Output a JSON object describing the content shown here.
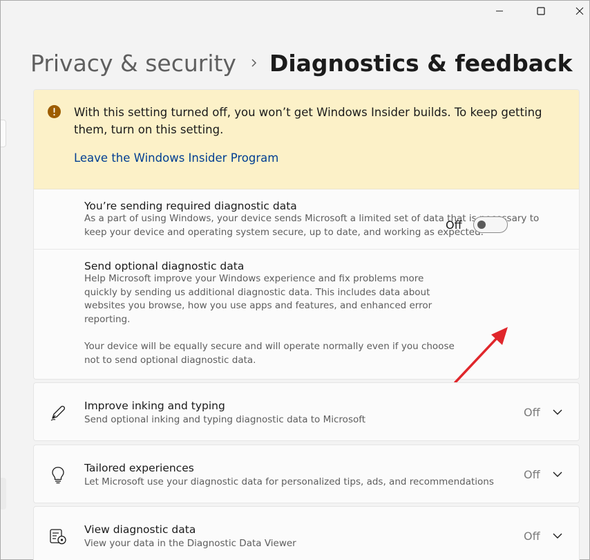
{
  "breadcrumb": {
    "parent": "Privacy & security",
    "current": "Diagnostics & feedback"
  },
  "banner": {
    "message": "With this setting turned off, you won’t get Windows Insider builds. To keep getting them, turn on this setting.",
    "link": "Leave the Windows Insider Program"
  },
  "required": {
    "title": "You’re sending required diagnostic data",
    "description": "As a part of using Windows, your device sends Microsoft a limited set of data that is necessary to keep your device and operating system secure, up to date, and working as expected."
  },
  "optional": {
    "title": "Send optional diagnostic data",
    "description": "Help Microsoft improve your Windows experience and fix problems more quickly by sending us additional diagnostic data. This includes data about websites you browse, how you use apps and features, and enhanced error reporting.",
    "note": "Your device will be equally secure and will operate normally even if you choose not to send optional diagnostic data.",
    "toggle_state": "Off"
  },
  "settings": [
    {
      "title": "Improve inking and typing",
      "description": "Send optional inking and typing diagnostic data to Microsoft",
      "state": "Off",
      "icon": "pen-icon"
    },
    {
      "title": "Tailored experiences",
      "description": "Let Microsoft use your diagnostic data for personalized tips, ads, and recommendations",
      "state": "Off",
      "icon": "lightbulb-icon"
    },
    {
      "title": "View diagnostic data",
      "description": "View your data in the Diagnostic Data Viewer",
      "state": "Off",
      "icon": "data-viewer-icon"
    }
  ],
  "colors": {
    "banner_bg": "#fcf1c8",
    "warning": "#9d5d00",
    "link": "#003e92",
    "annotation_arrow": "#e0262b"
  }
}
